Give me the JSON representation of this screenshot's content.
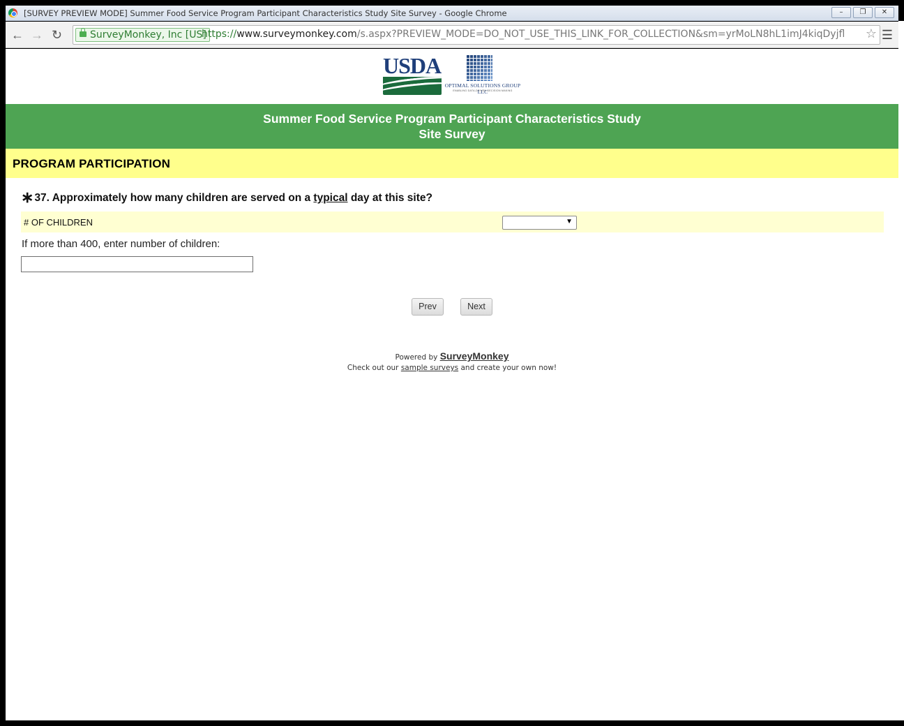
{
  "window": {
    "title": "[SURVEY PREVIEW MODE] Summer Food Service Program Participant Characteristics Study Site Survey - Google Chrome",
    "controls": {
      "minimize": "–",
      "restore": "❐",
      "close": "✕"
    }
  },
  "browser": {
    "ev_label": "SurveyMonkey, Inc [US]",
    "url_protocol": "https://",
    "url_host": "www.surveymonkey.com",
    "url_path": "/s.aspx?PREVIEW_MODE=DO_NOT_USE_THIS_LINK_FOR_COLLECTION&sm=yrMoLN8hL1imJ4kiqDyjfl",
    "back_icon": "←",
    "forward_icon": "→",
    "reload_icon": "↻",
    "star_icon": "☆",
    "menu_icon": "☰"
  },
  "logos": {
    "usda": "USDA",
    "osg_name": "OPTIMAL SOLUTIONS GROUP LLC",
    "osg_tagline": "ENABLING DATA-DRIVEN DECISION MAKING"
  },
  "survey": {
    "title_line1": "Summer Food Service Program Participant Characteristics Study",
    "title_line2": "Site Survey",
    "section": "PROGRAM PARTICIPATION",
    "question": {
      "required_mark": "∗",
      "prefix": "37. Approximately how many children are served on a ",
      "emphasis": "typical",
      "suffix": " day at this site?"
    },
    "matrix_row_label": "# OF CHILDREN",
    "select_value": "",
    "select_arrow": "▼",
    "other_label": "If more than 400, enter number of children:",
    "other_value": "",
    "prev_label": "Prev",
    "next_label": "Next"
  },
  "footer": {
    "powered_by": "Powered by ",
    "brand": "SurveyMonkey",
    "checkout_prefix": "Check out our ",
    "checkout_link": "sample surveys",
    "checkout_suffix": " and create your own now!"
  },
  "colors": {
    "header_green": "#4ea453",
    "section_yellow": "#ffff8c",
    "matrix_row_yellow": "#ffffd2"
  }
}
